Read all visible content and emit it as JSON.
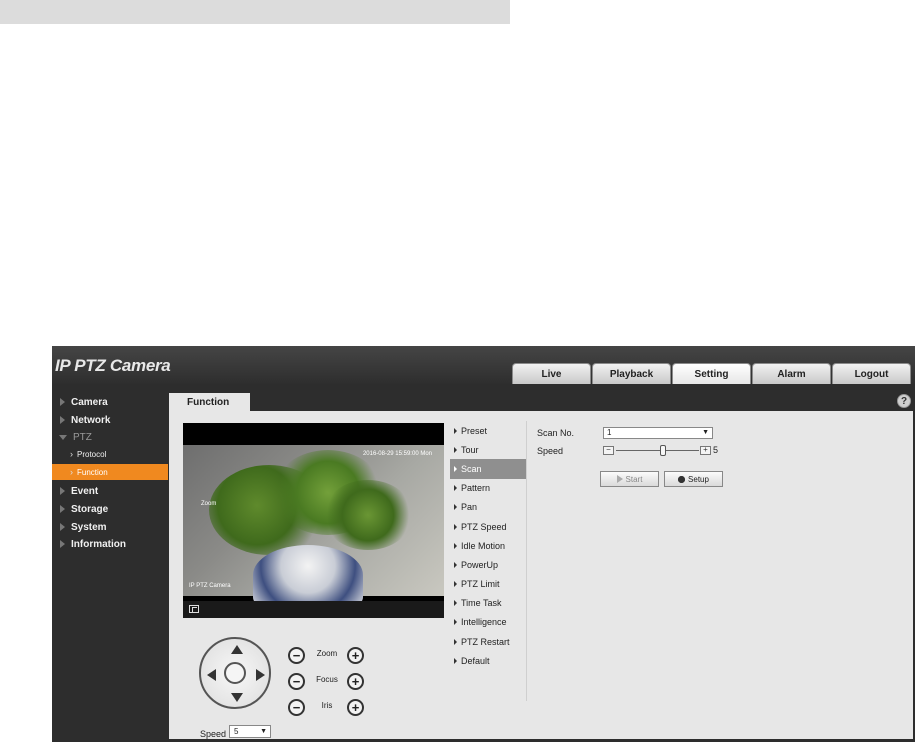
{
  "header": {
    "logo": "IP PTZ Camera",
    "tabs": [
      {
        "label": "Live"
      },
      {
        "label": "Playback"
      },
      {
        "label": "Setting"
      },
      {
        "label": "Alarm"
      },
      {
        "label": "Logout"
      }
    ],
    "active_tab": "Setting"
  },
  "sidebar": {
    "items": [
      {
        "label": "Camera"
      },
      {
        "label": "Network"
      },
      {
        "label": "PTZ"
      },
      {
        "label": "Protocol"
      },
      {
        "label": "Function"
      },
      {
        "label": "Event"
      },
      {
        "label": "Storage"
      },
      {
        "label": "System"
      },
      {
        "label": "Information"
      }
    ],
    "active_item": "Function"
  },
  "content": {
    "tab_label": "Function",
    "help_icon": "?"
  },
  "video": {
    "timestamp": "2016-08-29 15:59:00 Mon",
    "left_osd": "Zoom",
    "channel_name": "IP PTZ Camera"
  },
  "ptz_controls": {
    "speed_label": "Speed",
    "speed_value": "5",
    "zoom_label": "Zoom",
    "focus_label": "Focus",
    "iris_label": "Iris",
    "minus": "−",
    "plus": "+"
  },
  "function_menu": {
    "items": [
      {
        "label": "Preset"
      },
      {
        "label": "Tour"
      },
      {
        "label": "Scan"
      },
      {
        "label": "Pattern"
      },
      {
        "label": "Pan"
      },
      {
        "label": "PTZ Speed"
      },
      {
        "label": "Idle Motion"
      },
      {
        "label": "PowerUp"
      },
      {
        "label": "PTZ Limit"
      },
      {
        "label": "Time Task"
      },
      {
        "label": "Intelligence"
      },
      {
        "label": "PTZ Restart"
      },
      {
        "label": "Default"
      }
    ],
    "active_item": "Scan"
  },
  "scan_form": {
    "scan_no_label": "Scan No.",
    "scan_no_value": "1",
    "speed_label": "Speed",
    "speed_value": "5",
    "slider_minus": "−",
    "slider_plus": "+",
    "start_label": "Start",
    "setup_label": "Setup"
  },
  "icons": {
    "fullscreen": "fullscreen-icon",
    "help": "help-icon",
    "play": "play-icon",
    "gear": "gear-icon"
  },
  "colors": {
    "accent": "#f0891f",
    "selected_menu": "#8f8f8f",
    "background_dark": "#2d2d2d",
    "panel": "#e7e7e7"
  }
}
